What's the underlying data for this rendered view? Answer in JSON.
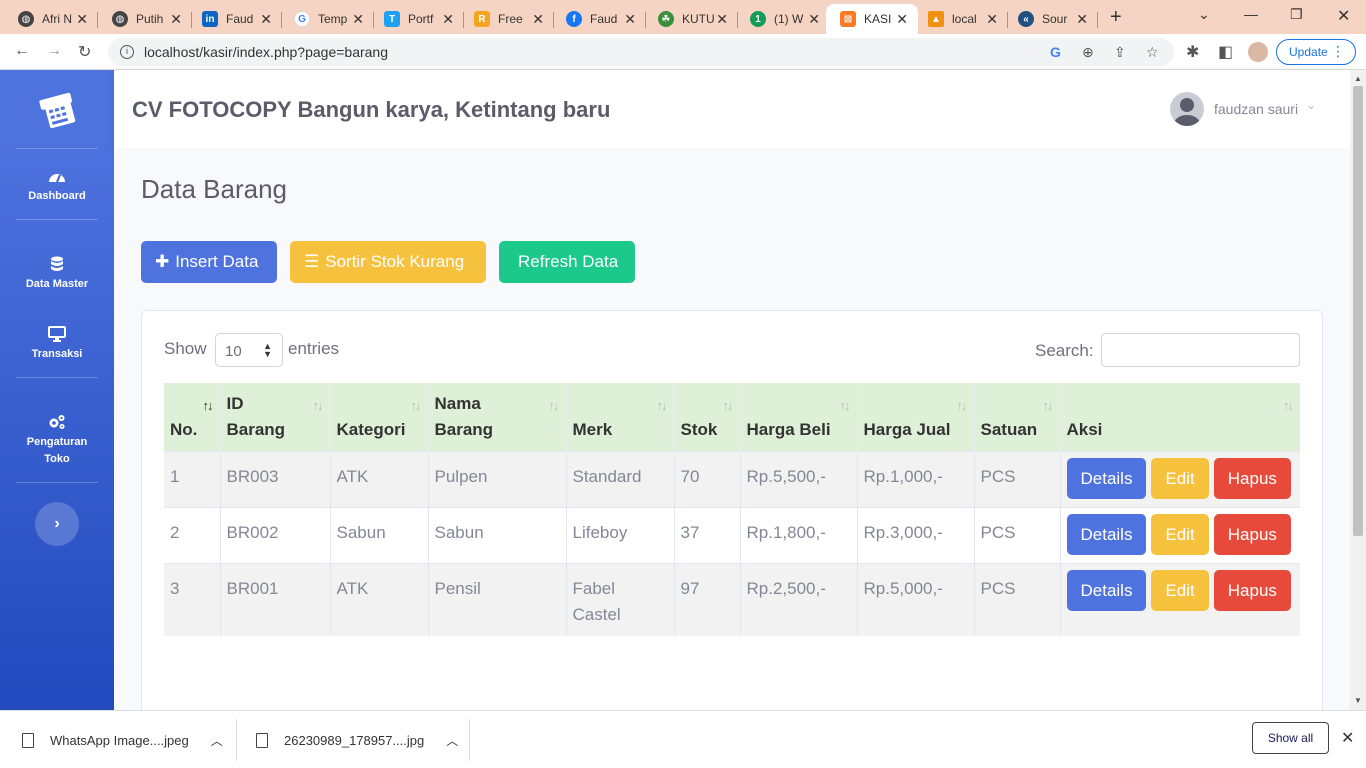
{
  "browser": {
    "tabs": [
      {
        "label": "Afri N",
        "icon": "globe-icon",
        "color": "#444444"
      },
      {
        "label": "Putih",
        "icon": "globe-icon",
        "color": "#444444"
      },
      {
        "label": "Faud",
        "icon": "linkedin-icon",
        "color": "#0a66c2"
      },
      {
        "label": "Temp",
        "icon": "google-icon",
        "color": "#4285f4"
      },
      {
        "label": "Portf",
        "icon": "t-app-icon",
        "color": "#1da1f2"
      },
      {
        "label": "Free",
        "icon": "r-app-icon",
        "color": "#f4a522"
      },
      {
        "label": "Faud",
        "icon": "facebook-icon",
        "color": "#1877f2"
      },
      {
        "label": "KUTU",
        "icon": "bug-icon",
        "color": "#3a8f3a"
      },
      {
        "label": "(1) W",
        "icon": "notification-icon",
        "color": "#0f9d58"
      },
      {
        "label": "KASI",
        "icon": "xampp-icon",
        "color": "#fb7a24",
        "active": true
      },
      {
        "label": "local",
        "icon": "phpmyadmin-icon",
        "color": "#f29111"
      },
      {
        "label": "Sour",
        "icon": "sourcetree-icon",
        "color": "#205081"
      }
    ],
    "url": "localhost/kasir/index.php?page=barang",
    "update_label": "Update"
  },
  "sidebar": {
    "items": [
      {
        "label": "Dashboard",
        "icon": "tachometer-icon"
      },
      {
        "label": "Data Master",
        "icon": "database-icon"
      },
      {
        "label": "Transaksi",
        "icon": "desktop-icon"
      },
      {
        "label": "Pengaturan Toko",
        "icon": "cogs-icon"
      }
    ]
  },
  "topbar": {
    "store_name": "CV FOTOCOPY Bangun karya, Ketintang baru",
    "user_name": "faudzan sauri"
  },
  "main": {
    "title": "Data Barang",
    "buttons": {
      "insert": "Insert Data",
      "sort": "Sortir Stok Kurang",
      "refresh": "Refresh Data"
    },
    "table_controls": {
      "show_label": "Show",
      "page_length": "10",
      "entries_label": "entries",
      "search_label": "Search:"
    },
    "table": {
      "headers": [
        "No.",
        "ID Barang",
        "Kategori",
        "Nama Barang",
        "Merk",
        "Stok",
        "Harga Beli",
        "Harga Jual",
        "Satuan",
        "Aksi"
      ],
      "rows": [
        {
          "no": "1",
          "id": "BR003",
          "kategori": "ATK",
          "nama": "Pulpen",
          "merk": "Standard",
          "stok": "70",
          "beli": "Rp.5,500,-",
          "jual": "Rp.1,000,-",
          "satuan": "PCS"
        },
        {
          "no": "2",
          "id": "BR002",
          "kategori": "Sabun",
          "nama": "Sabun",
          "merk": "Lifeboy",
          "stok": "37",
          "beli": "Rp.1,800,-",
          "jual": "Rp.3,000,-",
          "satuan": "PCS"
        },
        {
          "no": "3",
          "id": "BR001",
          "kategori": "ATK",
          "nama": "Pensil",
          "merk": "Fabel Castel",
          "stok": "97",
          "beli": "Rp.2,500,-",
          "jual": "Rp.5,000,-",
          "satuan": "PCS"
        }
      ],
      "actions": {
        "details": "Details",
        "edit": "Edit",
        "hapus": "Hapus"
      }
    }
  },
  "downloads": {
    "items": [
      "WhatsApp Image....jpeg",
      "26230989_178957....jpg"
    ],
    "show_all": "Show all"
  },
  "colors": {
    "sidebar_start": "#4e73df",
    "sidebar_end": "#224abe",
    "primary": "#4e73df",
    "warning": "#f6c23e",
    "success": "#1cc88a",
    "danger": "#e74a3b",
    "table_header": "#dff0d8",
    "tabstrip": "#f6d4c3"
  }
}
